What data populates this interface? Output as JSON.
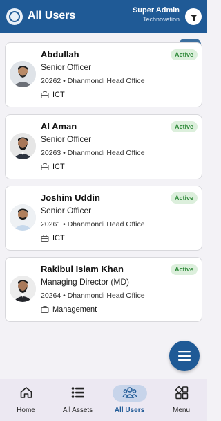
{
  "header": {
    "title": "All Users",
    "user_name": "Super Admin",
    "org_name": "Technovation"
  },
  "users": [
    {
      "name": "Abdullah",
      "role": "Senior Officer",
      "meta": "20262 • Dhanmondi Head Office",
      "department": "ICT",
      "status": "Active"
    },
    {
      "name": "Al Aman",
      "role": "Senior Officer",
      "meta": "20263 • Dhanmondi Head Office",
      "department": "ICT",
      "status": "Active"
    },
    {
      "name": "Joshim Uddin",
      "role": "Senior Officer",
      "meta": "20261 • Dhanmondi Head Office",
      "department": "ICT",
      "status": "Active"
    },
    {
      "name": "Rakibul Islam Khan",
      "role": "Managing Director (MD)",
      "meta": "20264 • Dhanmondi Head Office",
      "department": "Management",
      "status": "Active"
    }
  ],
  "bottom_nav": [
    {
      "label": "Home",
      "icon": "home-icon"
    },
    {
      "label": "All Assets",
      "icon": "list-icon"
    },
    {
      "label": "All Users",
      "icon": "users-icon",
      "active": true
    },
    {
      "label": "Menu",
      "icon": "grid-icon"
    }
  ],
  "colors": {
    "primary": "#1f5a96",
    "active_badge_bg": "#dcefdc",
    "active_badge_text": "#2f8a3a"
  }
}
